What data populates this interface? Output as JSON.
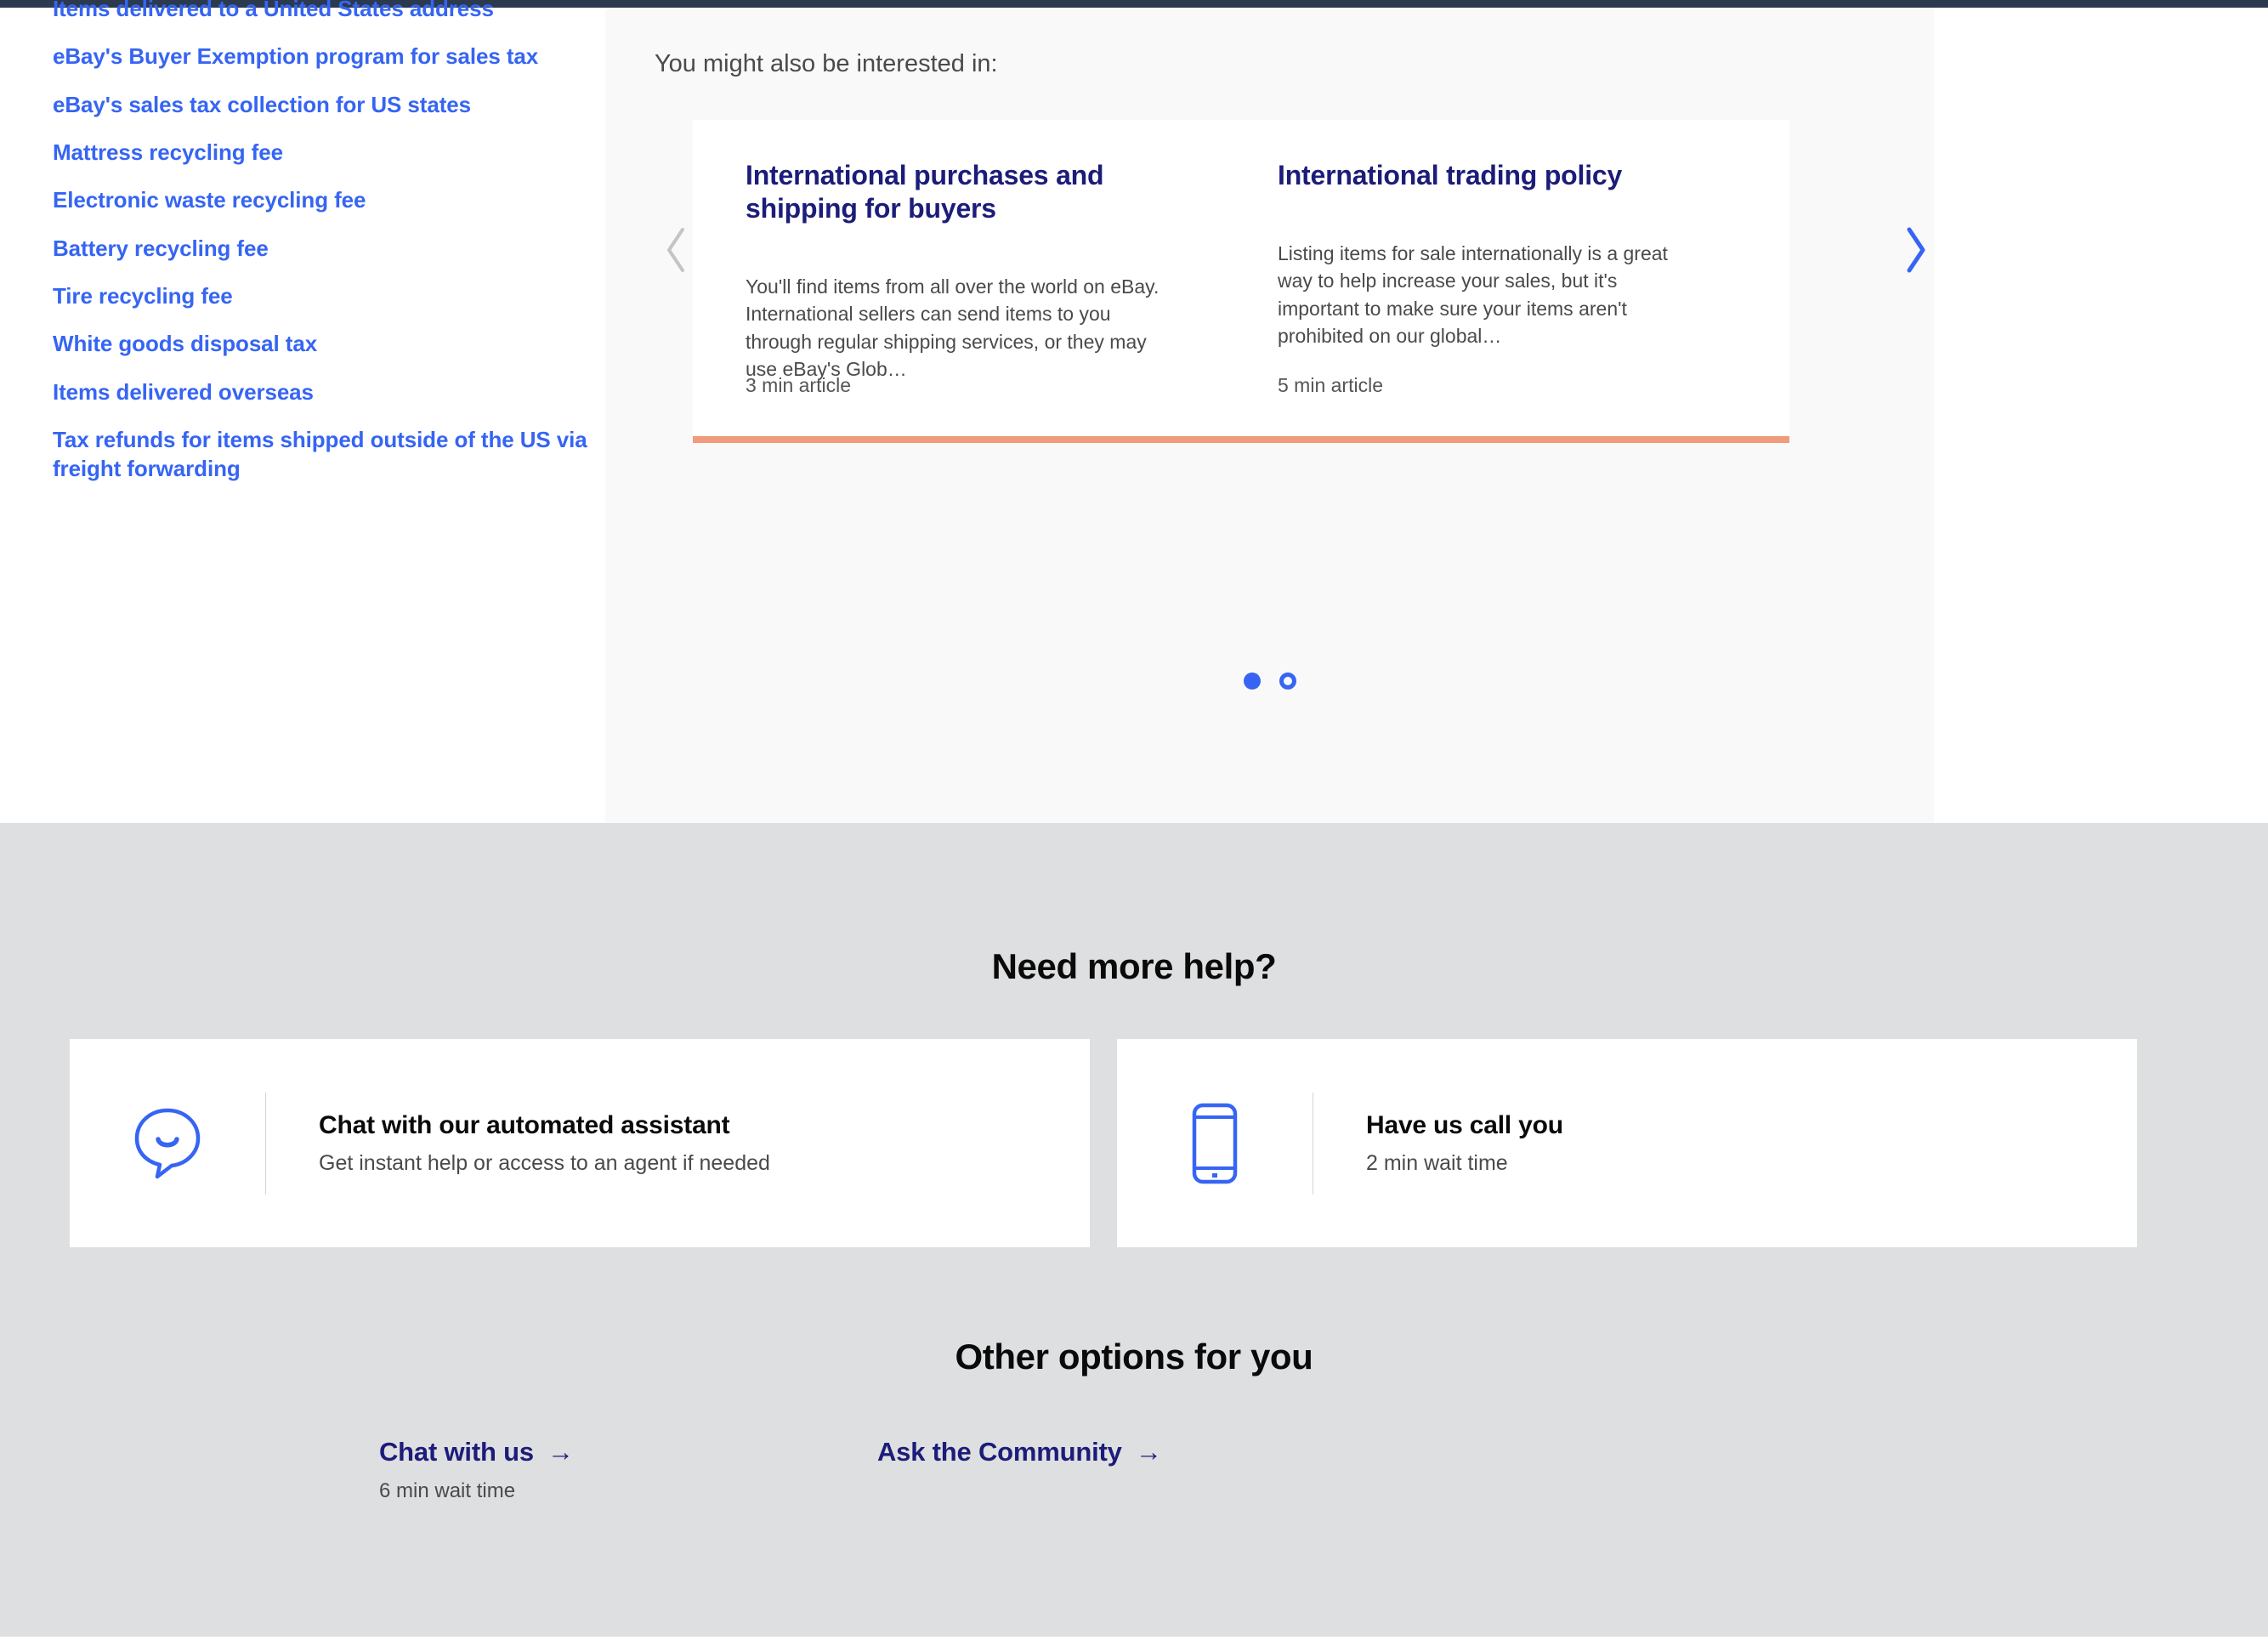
{
  "theme": {
    "brand_blue": "#3665f3",
    "deep_blue": "#1c1c7a",
    "accent_orange": "#ef9b7c",
    "panel_bg": "#f9f9f9",
    "help_bg": "#dedfe0",
    "navy_bar": "#2b3a4f"
  },
  "sidebar": {
    "links": [
      {
        "label": "Items delivered to a United States address"
      },
      {
        "label": "eBay's Buyer Exemption program for sales tax"
      },
      {
        "label": "eBay's sales tax collection for US states"
      },
      {
        "label": "Mattress recycling fee"
      },
      {
        "label": "Electronic waste recycling fee"
      },
      {
        "label": "Battery recycling fee"
      },
      {
        "label": "Tire recycling fee"
      },
      {
        "label": "White goods disposal tax"
      },
      {
        "label": "Items delivered overseas"
      },
      {
        "label": "Tax refunds for items shipped outside of the US via freight forwarding"
      }
    ]
  },
  "related": {
    "heading": "You might also be interested in:",
    "prev_label": "Previous",
    "next_label": "Next",
    "cards": [
      {
        "title": "International purchases and shipping for buyers",
        "body": "You'll find items from all over the world on eBay. International sellers can send items to you through regular shipping services, or they may use eBay's Glob…",
        "meta": "3 min article"
      },
      {
        "title": "International trading policy",
        "body": "Listing items for sale internationally is a great way to help increase your sales, but it's important to make sure your items aren't prohibited on our global…",
        "meta": "5 min article"
      }
    ],
    "pagination": [
      {
        "state": "active"
      },
      {
        "state": "inactive"
      }
    ]
  },
  "help": {
    "title": "Need more help?",
    "cards": [
      {
        "icon": "chat-bubble-icon",
        "heading": "Chat with our automated assistant",
        "sub": "Get instant help or access to an agent if needed"
      },
      {
        "icon": "mobile-phone-icon",
        "heading": "Have us call you",
        "sub": "2 min wait time"
      }
    ],
    "other_title": "Other options for you",
    "other_options": [
      {
        "label": "Chat with us",
        "arrow": "→",
        "sub": "6 min wait time"
      },
      {
        "label": "Ask the Community",
        "arrow": "→",
        "sub": ""
      }
    ]
  }
}
